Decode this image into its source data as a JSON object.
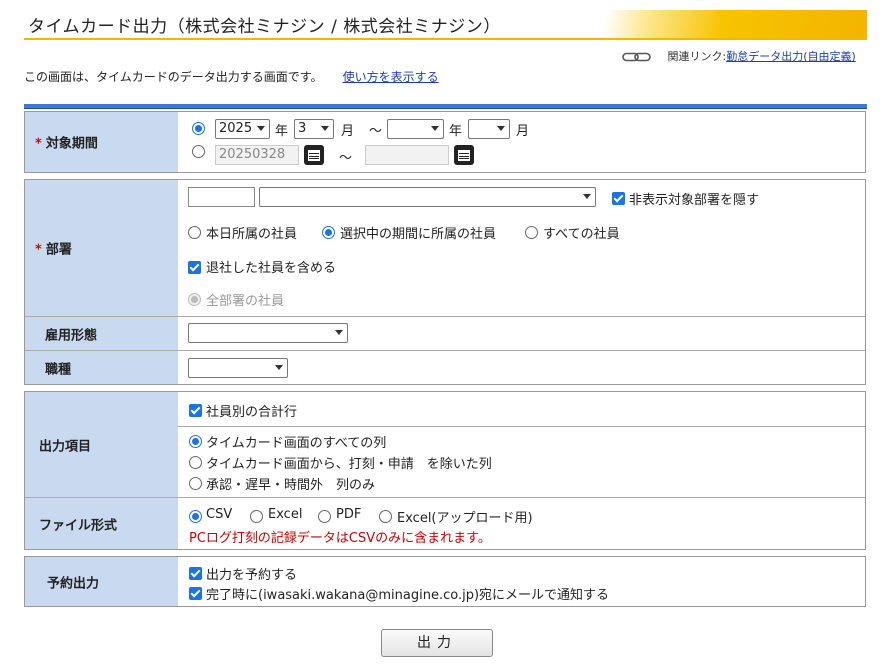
{
  "header": {
    "title": "タイムカード出力（株式会社ミナジン / 株式会社ミナジン）"
  },
  "related": {
    "label": "関連リンク:",
    "link": "勤怠データ出力(自由定義)"
  },
  "intro": {
    "text": "この画面は、タイムカードのデータ出力する画面です。",
    "help_link": "使い方を表示する"
  },
  "period": {
    "label": "対象期間",
    "required_mark": "*",
    "from_year": "2025",
    "year_unit": "年",
    "from_month": "3",
    "month_unit": "月",
    "tilde": "～",
    "to_year": "",
    "to_month": "",
    "date_from": "20250328",
    "date_to": ""
  },
  "dept": {
    "label": "部署",
    "required_mark": "*",
    "code": "",
    "name": "",
    "hide_label": "非表示対象部署を隠す",
    "opt_today": "本日所属の社員",
    "opt_period": "選択中の期間に所属の社員",
    "opt_all": "すべての社員",
    "retired_label": "退社した社員を含める",
    "all_dept_label": "全部署の社員"
  },
  "employment": {
    "label": "雇用形態",
    "value": ""
  },
  "jobtype": {
    "label": "職種",
    "value": ""
  },
  "output_items": {
    "label": "出力項目",
    "total_label": "社員別の合計行",
    "opt1": "タイムカード画面のすべての列",
    "opt2": "タイムカード画面から、打刻・申請　を除いた列",
    "opt3": "承認・遅早・時間外　列のみ"
  },
  "file_format": {
    "label": "ファイル形式",
    "csv": "CSV",
    "excel": "Excel",
    "pdf": "PDF",
    "excel_upload": "Excel(アップロード用)",
    "note": "PCログ打刻の記録データはCSVのみに含まれます。"
  },
  "reserve": {
    "label": "予約出力",
    "reserve_label": "出力を予約する",
    "notify_label": "完了時に(iwasaki.wakana@minagine.co.jp)宛にメールで通知する"
  },
  "submit": {
    "label": "出力"
  },
  "colors": {
    "accent": "#1a73e8",
    "label_bg": "#c9daf0",
    "title_gold": "#f4b400",
    "required": "#dd0000"
  }
}
